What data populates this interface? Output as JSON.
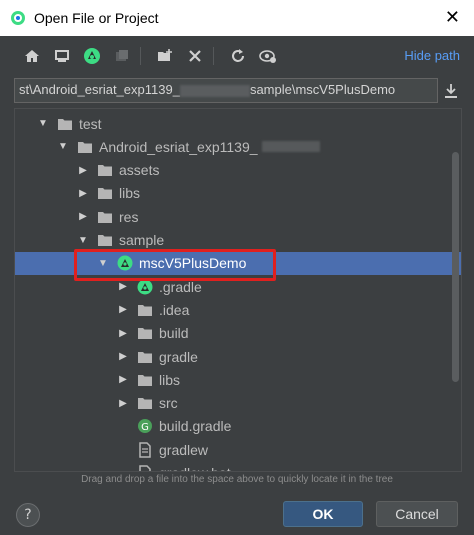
{
  "window": {
    "title": "Open File or Project",
    "close_glyph": "✕"
  },
  "toolbar": {
    "buttons": [
      {
        "name": "home-icon",
        "enabled": true
      },
      {
        "name": "desktop-icon",
        "enabled": true
      },
      {
        "name": "project-icon",
        "enabled": true
      },
      {
        "name": "module-icon",
        "enabled": false
      },
      {
        "name": "new-folder-icon",
        "enabled": true
      },
      {
        "name": "delete-icon",
        "enabled": true
      },
      {
        "name": "refresh-icon",
        "enabled": true
      },
      {
        "name": "show-hidden-icon",
        "enabled": true
      }
    ],
    "hide_path_label": "Hide path"
  },
  "path": {
    "value_prefix": "st\\Android_esriat_exp1139_",
    "value_suffix": "sample\\mscV5PlusDemo"
  },
  "tree": {
    "rows": [
      {
        "label": "test",
        "depth": 0,
        "expanded": true,
        "icon": "folder-icon"
      },
      {
        "label": "Android_esriat_exp1139_",
        "depth": 1,
        "expanded": true,
        "icon": "folder-icon",
        "blurred_suffix": true
      },
      {
        "label": "assets",
        "depth": 2,
        "expanded": false,
        "icon": "folder-icon"
      },
      {
        "label": "libs",
        "depth": 2,
        "expanded": false,
        "icon": "folder-icon"
      },
      {
        "label": "res",
        "depth": 2,
        "expanded": false,
        "icon": "folder-icon"
      },
      {
        "label": "sample",
        "depth": 2,
        "expanded": true,
        "icon": "folder-icon"
      },
      {
        "label": "mscV5PlusDemo",
        "depth": 3,
        "expanded": true,
        "icon": "android-project-icon",
        "selected": true
      },
      {
        "label": ".gradle",
        "depth": 4,
        "expanded": false,
        "icon": "android-folder-icon"
      },
      {
        "label": ".idea",
        "depth": 4,
        "expanded": false,
        "icon": "folder-icon"
      },
      {
        "label": "build",
        "depth": 4,
        "expanded": false,
        "icon": "folder-icon"
      },
      {
        "label": "gradle",
        "depth": 4,
        "expanded": false,
        "icon": "folder-icon"
      },
      {
        "label": "libs",
        "depth": 4,
        "expanded": false,
        "icon": "folder-icon"
      },
      {
        "label": "src",
        "depth": 4,
        "expanded": false,
        "icon": "folder-icon"
      },
      {
        "label": "build.gradle",
        "depth": 4,
        "leaf": true,
        "icon": "gradle-file-icon"
      },
      {
        "label": "gradlew",
        "depth": 4,
        "leaf": true,
        "icon": "file-icon"
      },
      {
        "label": "gradlew.bat",
        "depth": 4,
        "leaf": true,
        "icon": "file-icon"
      }
    ]
  },
  "hint": "Drag and drop a file into the space above to quickly locate it in the tree",
  "buttons": {
    "help": "?",
    "ok": "OK",
    "cancel": "Cancel"
  },
  "colors": {
    "background": "#3c3f41",
    "selection": "#4b6eaf",
    "accent_link": "#589df6",
    "highlight_box": "#e0201e",
    "ok_button": "#365880"
  }
}
